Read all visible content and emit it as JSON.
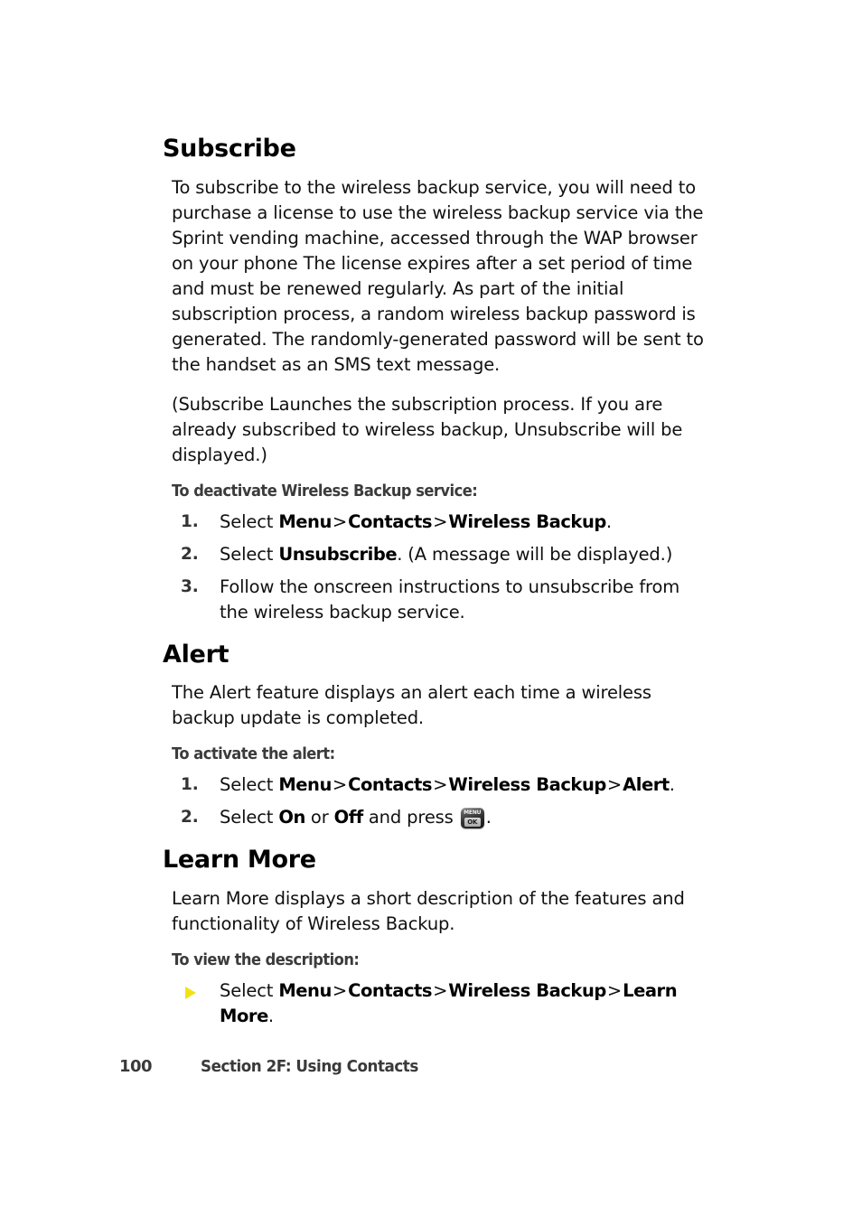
{
  "page": {
    "number": "100",
    "footer_label": "Section 2F: Using Contacts"
  },
  "sections": [
    {
      "heading": "Subscribe",
      "paragraphs": [
        "To subscribe to the wireless backup service, you will need to purchase a license to use the wireless backup service via the Sprint vending machine, accessed through the WAP browser on your phone The license expires after a set period of time and must be renewed regularly. As part of the initial subscription process, a random wireless backup password is generated. The randomly-generated password will be sent to the handset as an SMS text message.",
        "(Subscribe Launches the subscription process. If you are already subscribed to wireless backup, Unsubscribe will be displayed.)"
      ],
      "subheading": "To deactivate Wireless Backup service:",
      "steps": [
        {
          "number": "1.",
          "prefix": "Select ",
          "terms": [
            "Menu",
            "Contacts",
            "Wireless Backup"
          ],
          "suffix": "."
        },
        {
          "number": "2.",
          "prefix": "Select ",
          "terms": [
            "Unsubscribe"
          ],
          "suffix": ". (A message will be displayed.)"
        },
        {
          "number": "3.",
          "prefix": "Follow the onscreen instructions to unsubscribe from the wireless backup service.",
          "terms": [],
          "suffix": ""
        }
      ]
    },
    {
      "heading": "Alert",
      "paragraphs": [
        "The Alert feature displays an alert each time a wireless backup update is completed."
      ],
      "subheading": "To activate the alert:",
      "steps": [
        {
          "number": "1.",
          "prefix": "Select ",
          "terms": [
            "Menu",
            "Contacts",
            "Wireless Backup",
            "Alert"
          ],
          "suffix": "."
        },
        {
          "number": "2.",
          "prefix": "Select ",
          "terms": [
            "On",
            "Off"
          ],
          "suffix": "."
        }
      ]
    },
    {
      "heading": "Learn More",
      "paragraphs": [
        "Learn More displays a short description of the features and functionality of Wireless Backup."
      ],
      "subheading": "To view the description:",
      "bullet": {
        "prefix": "Select ",
        "terms": [
          "Menu",
          "Contacts",
          "Wireless Backup",
          "Learn More"
        ],
        "suffix": "."
      }
    }
  ],
  "inline": {
    "separator": ">",
    "alert_step2_mid_or": " or ",
    "alert_step2_after": " and press ",
    "key_icon": {
      "name": "menu-ok-key-icon",
      "top_label": "MENU",
      "bottom_label": "OK"
    },
    "bullet_icon": "triangle-bullet-icon"
  },
  "colors": {
    "bullet_yellow": "#f2e215",
    "subheading_gray": "#3b3b3b",
    "body_black": "#101010"
  }
}
